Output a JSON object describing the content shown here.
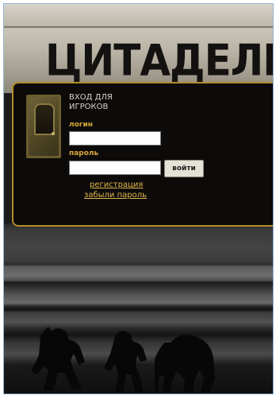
{
  "logo": {
    "text": "ЦИТАДЕЛЬ"
  },
  "login": {
    "title_line1": "ВХОД ДЛЯ",
    "title_line2": "ИГРОКОВ",
    "login_label": "логин",
    "login_value": "",
    "password_label": "пароль",
    "password_value": "",
    "submit_label": "войти",
    "register_link": "регистрация",
    "forgot_link": "забыли пароль"
  },
  "colors": {
    "accent": "#d9a83a",
    "link": "#e2b54a",
    "panel_bg": "#0c0b0a",
    "panel_border": "#b38a2a"
  },
  "icons": [
    "door-icon",
    "monster-silhouette-1",
    "monster-silhouette-2",
    "monster-silhouette-3"
  ]
}
